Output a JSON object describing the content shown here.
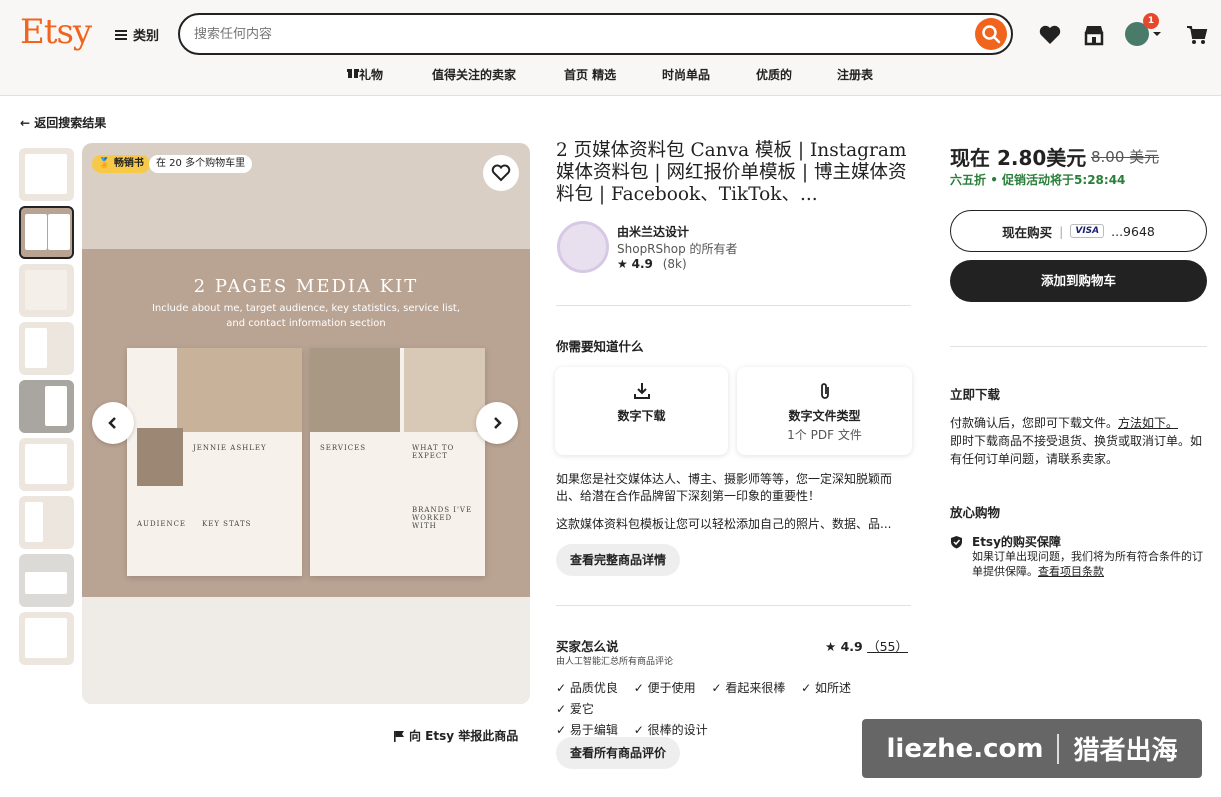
{
  "header": {
    "logo": "Etsy",
    "categories_label": "类别",
    "search_placeholder": "搜索任何内容",
    "cart_badge": "1"
  },
  "nav": [
    "礼物",
    "值得关注的卖家",
    "首页 精选",
    "时尚单品",
    "优质的",
    "注册表"
  ],
  "back_link": "返回搜索结果",
  "gallery": {
    "badge_sale": "畅销书",
    "badge_carts": "在 20 多个购物车里",
    "image": {
      "title": "2 PAGES MEDIA KIT",
      "subtitle": "Include about me, target audience, key statistics, service list, and contact information section",
      "left_doc_name": "JENNIE ASHLEY",
      "left_labels": [
        "AUDIENCE",
        "KEY STATS"
      ],
      "right_labels": [
        "SERVICES",
        "WHAT TO EXPECT",
        "BRANDS I'VE WORKED WITH"
      ]
    },
    "report_link": "向 Etsy 举报此商品"
  },
  "product": {
    "title": "2 页媒体资料包 Canva 模板 | Instagram 媒体资料包 | 网红报价单模板 | 博主媒体资料包 | Facebook、TikTok、...",
    "shop_name": "由米兰达设计",
    "shop_owner": "ShopRShop 的所有者",
    "shop_rating": "4.9",
    "shop_reviews": "(8k)"
  },
  "need_to_know": {
    "heading": "你需要知道什么",
    "box1_title": "数字下载",
    "box2_title": "数字文件类型",
    "box2_sub": "1个 PDF 文件"
  },
  "description": {
    "p1": "如果您是社交媒体达人、博主、摄影师等等，您一定深知脱颖而出、给潜在合作品牌留下深刻第一印象的重要性！",
    "p2": "这款媒体资料包模板让您可以轻松添加自己的照片、数据、品...",
    "more_button": "查看完整商品详情"
  },
  "reviews": {
    "heading": "买家怎么说",
    "sub": "由人工智能汇总所有商品评论",
    "rating": "4.9",
    "count": "（55）",
    "tags": [
      "品质优良",
      "便于使用",
      "看起来很棒",
      "如所述",
      "爱它",
      "易于编辑",
      "很棒的设计"
    ],
    "all_button": "查看所有商品评价"
  },
  "purchase": {
    "price": "现在 2.80美元",
    "old_price": "8.00 美元",
    "discount": "六五折",
    "promo": "促销活动将于5:28:44",
    "buy_now": "现在购买",
    "card_brand": "VISA",
    "card_last": "...9648",
    "add_to_cart": "添加到购物车",
    "instant_heading": "立即下载",
    "instant_text_a": "付款确认后，您即可下载文件。",
    "instant_link": "方法如下。",
    "instant_text_b": "即时下载商品不接受退货、换货或取消订单。如有任何订单问题，请联系卖家。",
    "safe_heading": "放心购物",
    "protect_title": "Etsy的购买保障",
    "protect_text": "如果订单出现问题，我们将为所有符合条件的订单提供保障。",
    "protect_link": "查看项目条款"
  },
  "watermark": {
    "left": "liezhe.com",
    "right": "猎者出海"
  },
  "colors": {
    "brand": "#f1641e",
    "sale_green": "#2a7e3a",
    "dark_button": "#222222"
  }
}
